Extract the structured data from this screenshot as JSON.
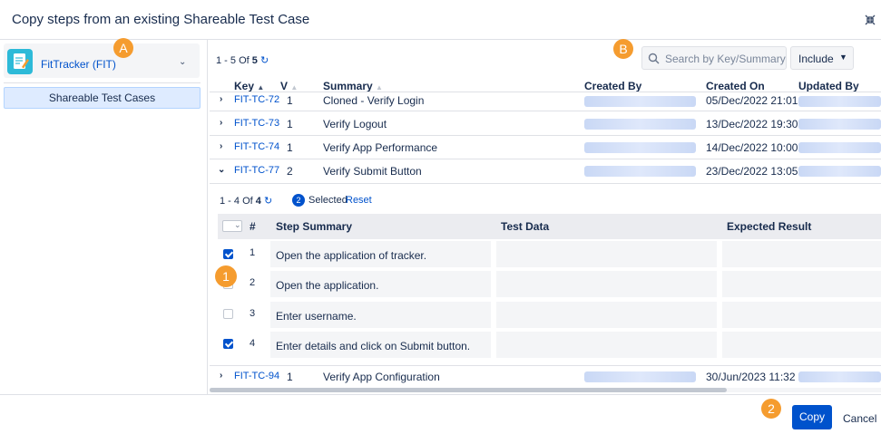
{
  "dialog": {
    "title": "Copy steps from an existing Shareable Test Case"
  },
  "sidebar": {
    "project": "FitTracker (FIT)",
    "item": "Shareable Test Cases"
  },
  "toolbar": {
    "count_prefix": "1 - 5 Of",
    "count_total": "5",
    "search_placeholder": "Search by Key/Summary",
    "include": "Include"
  },
  "table": {
    "headers": {
      "key": "Key",
      "v": "V",
      "summary": "Summary",
      "created_by": "Created By",
      "created_on": "Created On",
      "updated_by": "Updated By"
    },
    "rows": [
      {
        "key": "FIT-TC-72",
        "v": "1",
        "summary": "Cloned - Verify Login",
        "created_on": "05/Dec/2022 21:01"
      },
      {
        "key": "FIT-TC-73",
        "v": "1",
        "summary": "Verify Logout",
        "created_on": "13/Dec/2022 19:30"
      },
      {
        "key": "FIT-TC-74",
        "v": "1",
        "summary": "Verify App Performance",
        "created_on": "14/Dec/2022 10:00"
      },
      {
        "key": "FIT-TC-77",
        "v": "2",
        "summary": "Verify Submit Button",
        "created_on": "23/Dec/2022 13:05"
      },
      {
        "key": "FIT-TC-94",
        "v": "1",
        "summary": "Verify App Configuration",
        "created_on": "30/Jun/2023 11:32"
      }
    ]
  },
  "steps": {
    "count_prefix": "1 - 4 Of",
    "count_total": "4",
    "selected_count": "2",
    "selected_label": "Selected",
    "reset": "Reset",
    "headers": {
      "num": "#",
      "summary": "Step Summary",
      "data": "Test Data",
      "expected": "Expected Result"
    },
    "rows": [
      {
        "num": "1",
        "summary": "Open the application of tracker.",
        "checked": true
      },
      {
        "num": "2",
        "summary": "Open the application.",
        "checked": false
      },
      {
        "num": "3",
        "summary": "Enter username.",
        "checked": false
      },
      {
        "num": "4",
        "summary": "Enter details and click on Submit button.",
        "checked": true
      }
    ]
  },
  "callouts": {
    "a": "A",
    "b": "B",
    "one": "1",
    "two": "2"
  },
  "footer": {
    "copy": "Copy",
    "cancel": "Cancel"
  },
  "colors": {
    "accent": "#0052cc",
    "callout": "#f59c2f",
    "highlight": "#deebff"
  }
}
